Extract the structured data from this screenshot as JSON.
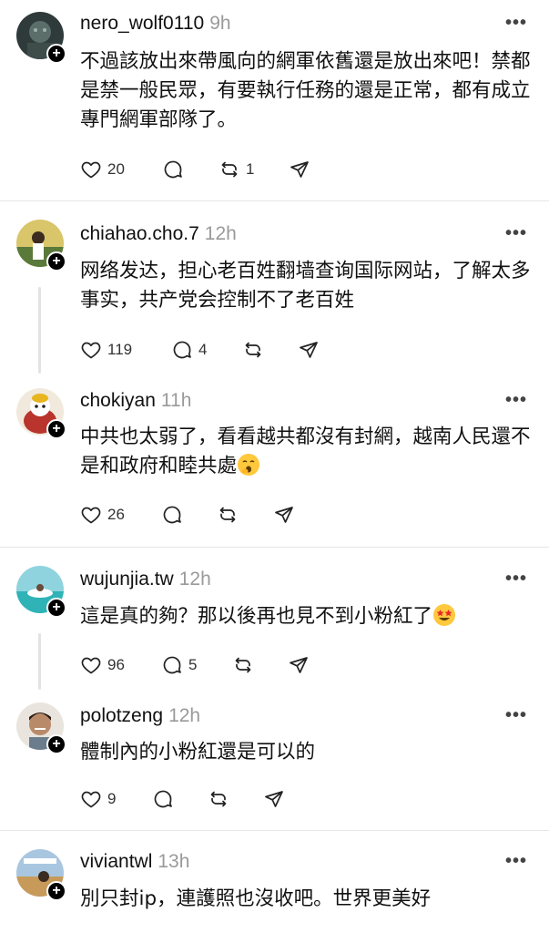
{
  "posts": [
    {
      "username": "nero_wolf0110",
      "time": "9h",
      "text": "不過該放出來帶風向的網軍依舊還是放出來吧！禁都是禁一般民眾，有要執行任務的還是正常，都有成立專門網軍部隊了。",
      "likes": "20",
      "replies": "",
      "reposts": "1"
    },
    {
      "username": "chiahao.cho.7",
      "time": "12h",
      "text": "网络发达，担心老百姓翻墙查询国际网站，了解太多事实，共产党会控制不了老百姓",
      "likes": "119",
      "replies": "4",
      "reposts": ""
    },
    {
      "username": "chokiyan",
      "time": "11h",
      "text": "中共也太弱了，看看越共都沒有封網，越南人民還不是和政府和睦共處",
      "likes": "26",
      "replies": "",
      "reposts": ""
    },
    {
      "username": "wujunjia.tw",
      "time": "12h",
      "text": "這是真的夠？那以後再也見不到小粉紅了",
      "likes": "96",
      "replies": "5",
      "reposts": ""
    },
    {
      "username": "polotzeng",
      "time": "12h",
      "text": "體制內的小粉紅還是可以的",
      "likes": "9",
      "replies": "",
      "reposts": ""
    },
    {
      "username": "viviantwl",
      "time": "13h",
      "text": "別只封ip，連護照也沒收吧。世界更美好",
      "likes": "",
      "replies": "",
      "reposts": ""
    }
  ],
  "icons": {
    "more": "more-horizontal-icon",
    "like": "heart-icon",
    "reply": "comment-bubble-icon",
    "repost": "repost-icon",
    "share": "send-icon",
    "follow": "plus-icon"
  },
  "colors": {
    "text": "#111111",
    "muted": "#9a9a9a",
    "divider": "#e6e6e6",
    "thread_line": "#e3e3e3"
  }
}
